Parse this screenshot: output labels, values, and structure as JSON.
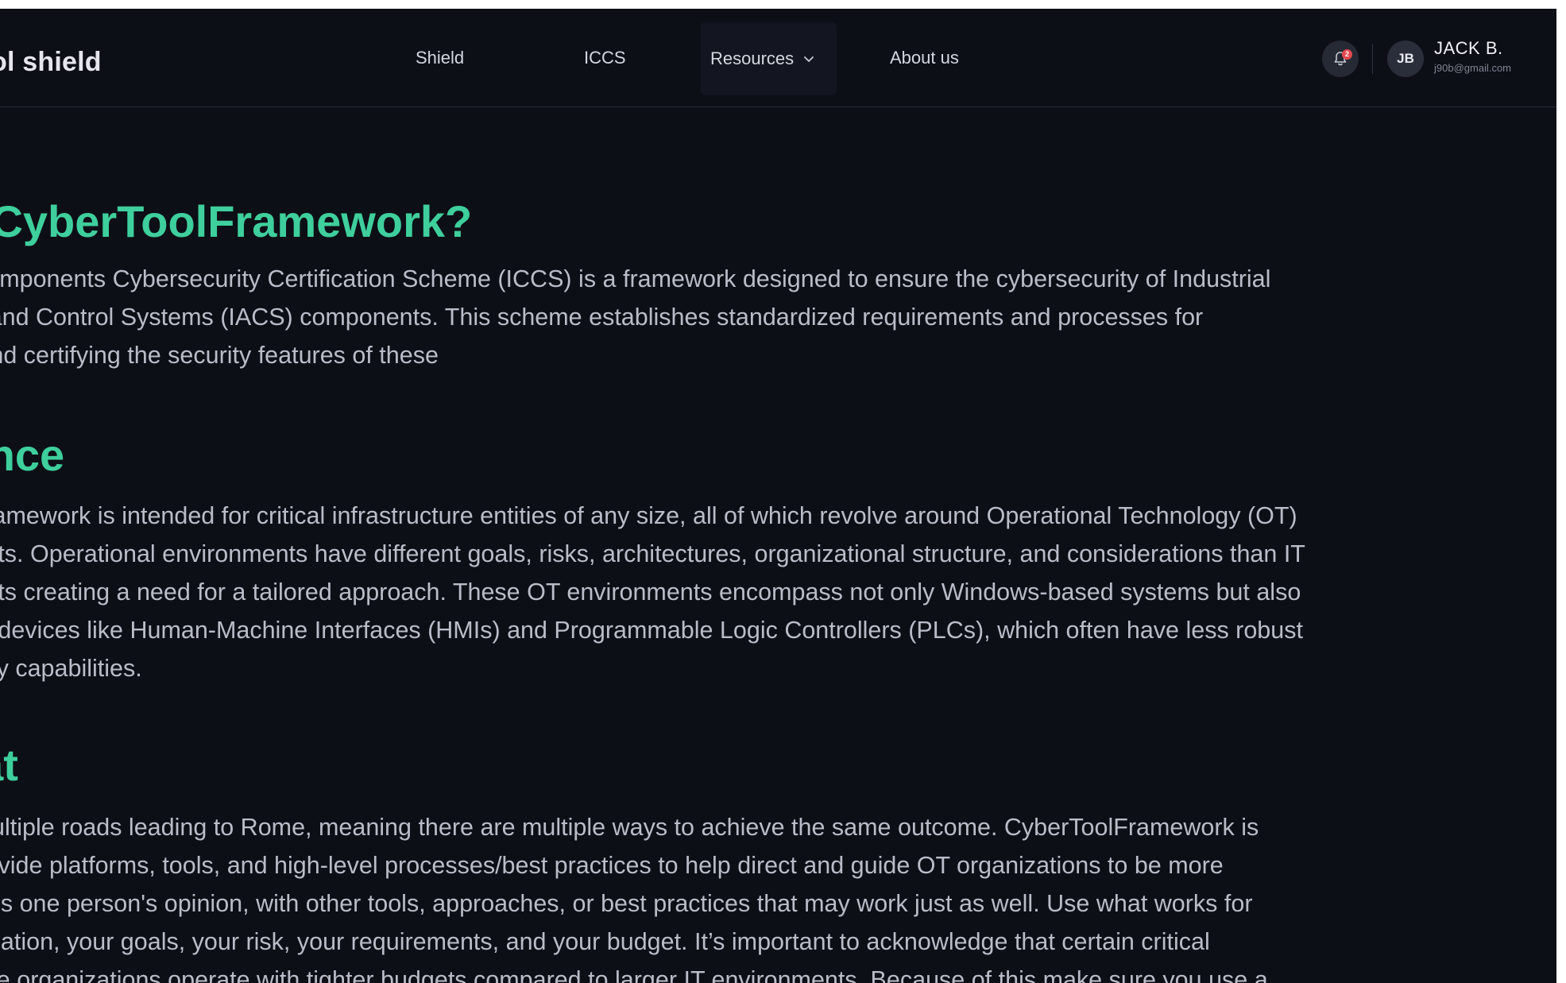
{
  "header": {
    "logo": "ol shield",
    "nav": {
      "shield": "Shield",
      "iccs": "ICCS",
      "resources": "Resources",
      "about": "About us"
    },
    "notifications": {
      "count": "2"
    },
    "user": {
      "initials": "JB",
      "name": "JACK B.",
      "email": "j90b@gmail.com"
    }
  },
  "content": {
    "sections": [
      {
        "title": "t is CyberToolFramework?",
        "text": "al Components Cybersecurity Certification Scheme (ICCS) is a framework designed to ensure the cybersecurity of Industrial\ntion and Control Systems (IACS) components. This scheme establishes standardized requirements and processes for\nng and certifying the security features of these"
      },
      {
        "title": "ience",
        "text": "olFramework is intended for critical infrastructure entities of any size, all of which revolve around Operational Technology (OT)\nments. Operational environments have different goals, risks, architectures, organizational structure, and considerations than IT\nments creating a need for a tailored approach. These OT environments encompass not only Windows-based systems but also\nand devices like Human-Machine Interfaces (HMIs) and Programmable Logic Controllers (PLCs), which often have less robust\ncurity capabilities."
      },
      {
        "title": "eat",
        "text": "re multiple roads leading to Rome, meaning there are multiple ways to achieve the same outcome. CyberToolFramework is\no provide platforms, tools, and high-level processes/best practices to help direct and guide OT organizations to be more\nThis is one person's opinion, with other tools, approaches, or best practices that may work just as well. Use what works for\nganization, your goals, your risk, your requirements, and your budget. It’s important to acknowledge that certain critical\nucture organizations operate with tighter budgets compared to larger IT environments. Because of this make sure you use a"
      }
    ]
  },
  "colors": {
    "background": "#0d0f17",
    "accent": "#3ecf9c",
    "text": "#b9bdc7",
    "badge": "#e5484d"
  },
  "icons": {
    "resources_dropdown": "chevron-down-icon",
    "notifications": "bell-icon"
  }
}
